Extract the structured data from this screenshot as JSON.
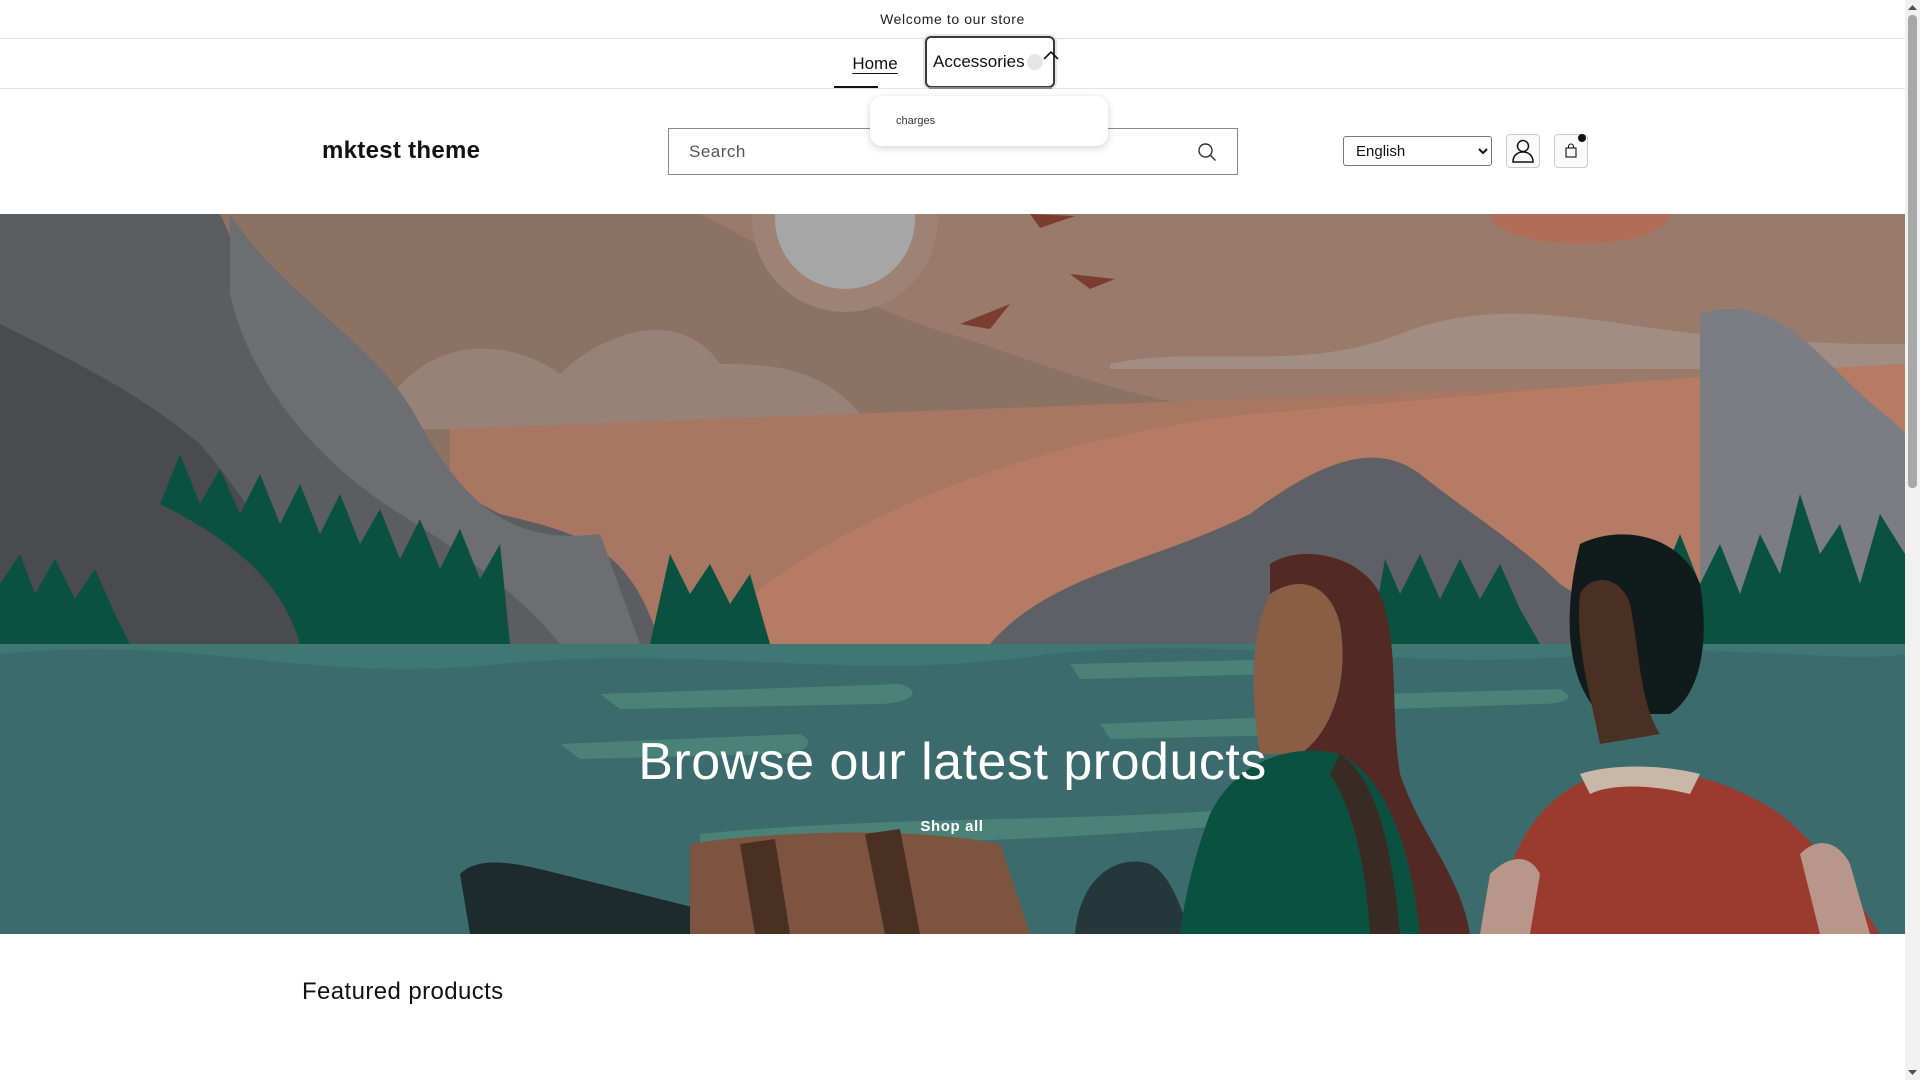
{
  "announcement": {
    "text": "Welcome to our store"
  },
  "nav": {
    "items": [
      {
        "label": "Home"
      },
      {
        "label": "Accessories"
      }
    ],
    "dropdown": {
      "items": [
        {
          "label": "charges"
        }
      ]
    }
  },
  "header": {
    "logo": "mktest theme",
    "search": {
      "placeholder": "Search",
      "value": ""
    },
    "language": {
      "selected": "English",
      "options": [
        "English"
      ]
    },
    "icons": {
      "search": "search-icon",
      "account": "account-icon",
      "cart": "cart-icon"
    }
  },
  "hero": {
    "heading": "Browse our latest products",
    "link_label": "Shop all"
  },
  "featured": {
    "title": "Featured products"
  },
  "colors": {
    "sky": "#8c7263",
    "water": "#3c6b6e",
    "mountain": "#5b5d61",
    "trees": "#0b5140",
    "sun": "#a6a6a6"
  }
}
